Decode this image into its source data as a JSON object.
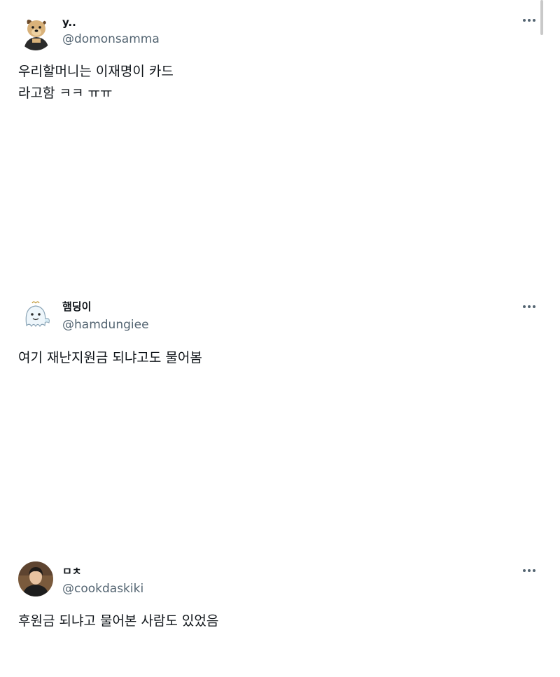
{
  "tweets": [
    {
      "display_name": "y..",
      "handle": "@domonsamma",
      "text": "우리할머니는 이재명이 카드\n라고함 ㅋㅋ ㅠㅠ",
      "avatar_icon": "dog-avatar-icon"
    },
    {
      "display_name": "햄딩이",
      "handle": "@hamdungiee",
      "text": "여기 재난지원금 되냐고도 물어봄",
      "avatar_icon": "cartoon-ghost-avatar-icon"
    },
    {
      "display_name": "ㅁㅊ",
      "handle": "@cookdaskiki",
      "text": "후원금 되냐고 물어본 사람도 있었음",
      "avatar_icon": "person-photo-avatar-icon"
    }
  ],
  "colors": {
    "text": "#0f1419",
    "secondary": "#536471",
    "background": "#ffffff"
  }
}
